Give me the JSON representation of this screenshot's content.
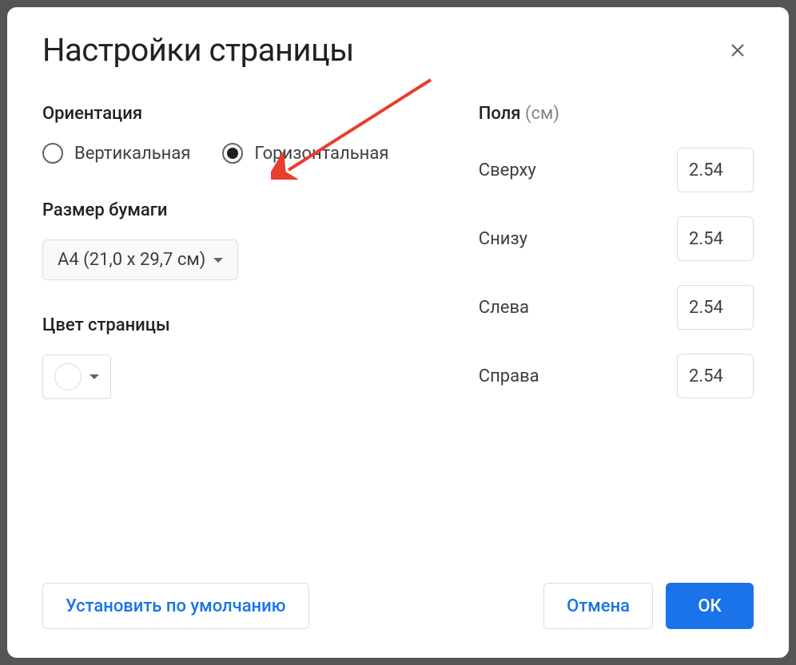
{
  "dialog": {
    "title": "Настройки страницы"
  },
  "orientation": {
    "label": "Ориентация",
    "options": {
      "portrait": "Вертикальная",
      "landscape": "Горизонтальная"
    },
    "selected": "landscape"
  },
  "paper_size": {
    "label": "Размер бумаги",
    "selected": "A4 (21,0 x 29,7 см)"
  },
  "page_color": {
    "label": "Цвет страницы",
    "value": "#ffffff"
  },
  "margins": {
    "label": "Поля",
    "unit": "(см)",
    "fields": {
      "top": {
        "label": "Сверху",
        "value": "2.54"
      },
      "bottom": {
        "label": "Снизу",
        "value": "2.54"
      },
      "left": {
        "label": "Слева",
        "value": "2.54"
      },
      "right": {
        "label": "Справа",
        "value": "2.54"
      }
    }
  },
  "footer": {
    "set_default": "Установить по умолчанию",
    "cancel": "Отмена",
    "ok": "ОК"
  }
}
